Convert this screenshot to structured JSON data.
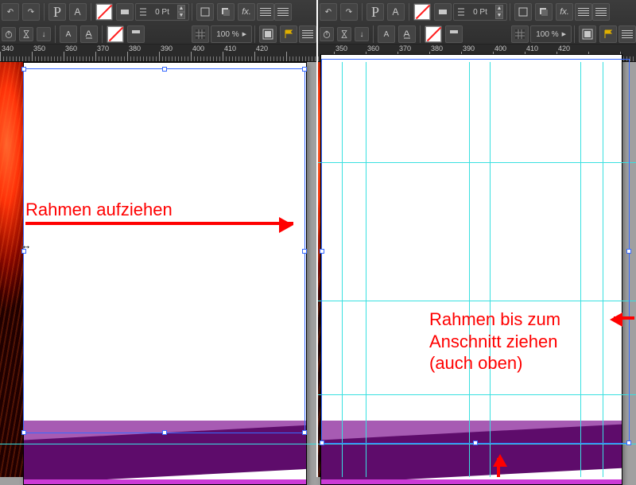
{
  "toolbar": {
    "p_glyph": "P",
    "stroke_field": "0 Pt",
    "opacity_field": "100 %",
    "fx_label": "fx."
  },
  "ruler": {
    "left_labels": [
      "340",
      "350",
      "360",
      "370",
      "380",
      "390",
      "400",
      "410",
      "420"
    ],
    "right_labels": [
      "350",
      "360",
      "370",
      "380",
      "390",
      "400",
      "410",
      "420"
    ]
  },
  "annotations": {
    "left": "Rahmen aufziehen",
    "right": "Rahmen bis zum\nAnschnitt ziehen\n(auch oben)"
  }
}
